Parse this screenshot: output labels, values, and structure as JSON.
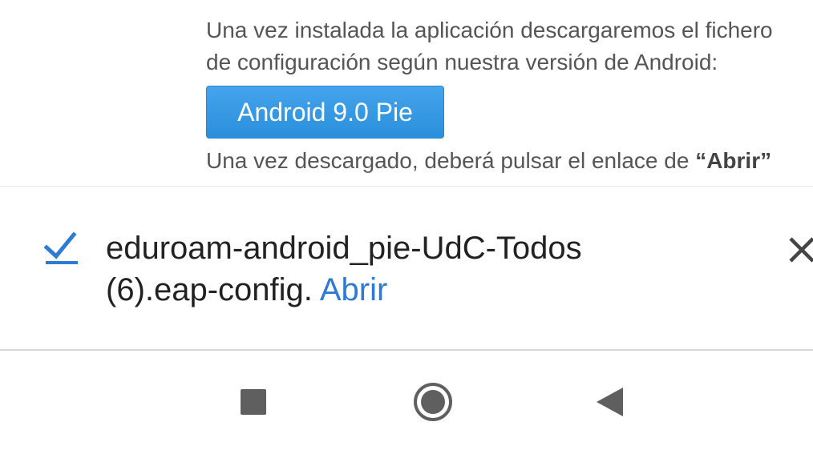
{
  "web_content": {
    "paragraph1_line1": "Una vez instalada la aplicación descargaremos el fichero",
    "paragraph1_line2": "de configuración según nuestra versión de Android:",
    "android_button_label": "Android 9.0 Pie",
    "paragraph2_prefix": "Una vez descargado, deberá pulsar el enlace de ",
    "paragraph2_bold": "“Abrir”"
  },
  "download_bar": {
    "status_icon": "check-icon",
    "filename_line1": "eduroam-android_pie-UdC-Todos",
    "filename_line2": "(6).eap-config.",
    "open_label": "Abrir",
    "close_icon": "close-icon"
  },
  "navigation": {
    "recents_icon": "square-recents-icon",
    "home_icon": "circle-home-icon",
    "back_icon": "triangle-back-icon"
  },
  "colors": {
    "accent_blue": "#2e7bd6",
    "button_blue": "#2a8fdc",
    "text_gray": "#555555",
    "nav_gray": "#5f5f5f"
  }
}
